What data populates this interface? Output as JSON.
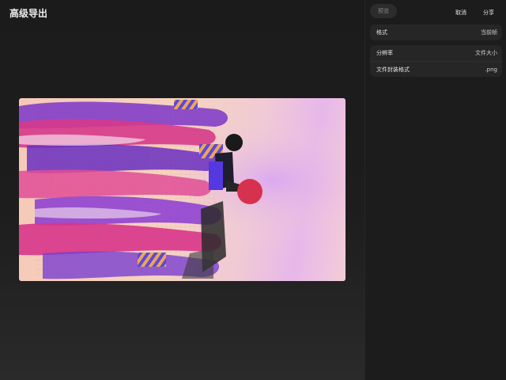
{
  "main": {
    "title": "高级导出"
  },
  "panel": {
    "preview_label": "预览",
    "cancel_label": "取消",
    "share_label": "分享",
    "format_group": [
      {
        "label": "格式",
        "value": "当前帧"
      }
    ],
    "settings_group": [
      {
        "label": "分辨率",
        "value": "文件大小"
      },
      {
        "label": "文件封装格式",
        "value": ".png"
      }
    ]
  },
  "colors": {
    "background": "#1b1b1b",
    "panel": "#1c1c1c",
    "group": "#262626",
    "accent_magenta": "#d63a8a",
    "accent_purple": "#7a3fd0",
    "accent_orange": "#f0a45a"
  }
}
